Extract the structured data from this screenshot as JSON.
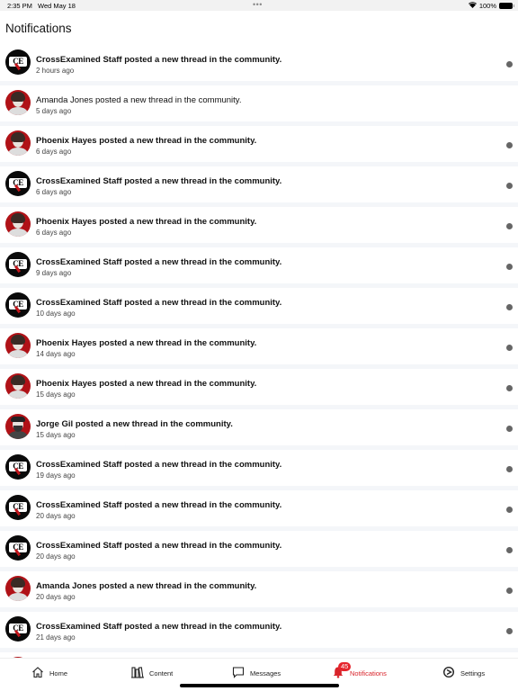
{
  "status_bar": {
    "time": "2:35 PM",
    "date": "Wed May 18",
    "battery": "100%"
  },
  "header": {
    "title": "Notifications"
  },
  "notifications": [
    {
      "author": "CrossExamined Staff",
      "avatar": "ce-logo",
      "text": "CrossExamined Staff posted a new thread in the community.",
      "time": "2 hours ago",
      "unread": true
    },
    {
      "author": "Amanda Jones",
      "avatar": "amanda",
      "text": "Amanda Jones posted a new thread in the community.",
      "time": "5 days ago",
      "unread": false
    },
    {
      "author": "Phoenix Hayes",
      "avatar": "phoenix",
      "text": "Phoenix Hayes posted a new thread in the community.",
      "time": "6 days ago",
      "unread": true
    },
    {
      "author": "CrossExamined Staff",
      "avatar": "ce-logo",
      "text": "CrossExamined Staff posted a new thread in the community.",
      "time": "6 days ago",
      "unread": true
    },
    {
      "author": "Phoenix Hayes",
      "avatar": "phoenix",
      "text": "Phoenix Hayes posted a new thread in the community.",
      "time": "6 days ago",
      "unread": true
    },
    {
      "author": "CrossExamined Staff",
      "avatar": "ce-logo",
      "text": "CrossExamined Staff posted a new thread in the community.",
      "time": "9 days ago",
      "unread": true
    },
    {
      "author": "CrossExamined Staff",
      "avatar": "ce-logo",
      "text": "CrossExamined Staff posted a new thread in the community.",
      "time": "10 days ago",
      "unread": true
    },
    {
      "author": "Phoenix Hayes",
      "avatar": "phoenix",
      "text": "Phoenix Hayes posted a new thread in the community.",
      "time": "14 days ago",
      "unread": true
    },
    {
      "author": "Phoenix Hayes",
      "avatar": "phoenix",
      "text": "Phoenix Hayes posted a new thread in the community.",
      "time": "15 days ago",
      "unread": true
    },
    {
      "author": "Jorge Gil",
      "avatar": "jorge",
      "text": "Jorge Gil posted a new thread in the community.",
      "time": "15 days ago",
      "unread": true
    },
    {
      "author": "CrossExamined Staff",
      "avatar": "ce-logo",
      "text": "CrossExamined Staff posted a new thread in the community.",
      "time": "19 days ago",
      "unread": true
    },
    {
      "author": "CrossExamined Staff",
      "avatar": "ce-logo",
      "text": "CrossExamined Staff posted a new thread in the community.",
      "time": "20 days ago",
      "unread": true
    },
    {
      "author": "CrossExamined Staff",
      "avatar": "ce-logo",
      "text": "CrossExamined Staff posted a new thread in the community.",
      "time": "20 days ago",
      "unread": true
    },
    {
      "author": "Amanda Jones",
      "avatar": "amanda",
      "text": "Amanda Jones posted a new thread in the community.",
      "time": "20 days ago",
      "unread": true
    },
    {
      "author": "CrossExamined Staff",
      "avatar": "ce-logo",
      "text": "CrossExamined Staff posted a new thread in the community.",
      "time": "21 days ago",
      "unread": true
    }
  ],
  "ce_logo_text": "CE",
  "tabbar": {
    "tabs": [
      {
        "label": "Home",
        "icon": "home-icon"
      },
      {
        "label": "Content",
        "icon": "books-icon"
      },
      {
        "label": "Messages",
        "icon": "chat-bubble-icon"
      },
      {
        "label": "Notifications",
        "icon": "bell-icon",
        "active": true,
        "badge": "45"
      },
      {
        "label": "Settings",
        "icon": "gear-icon"
      }
    ]
  },
  "colors": {
    "accent": "#d8232a",
    "badge": "#e5252d",
    "unread_dot": "#666666"
  }
}
